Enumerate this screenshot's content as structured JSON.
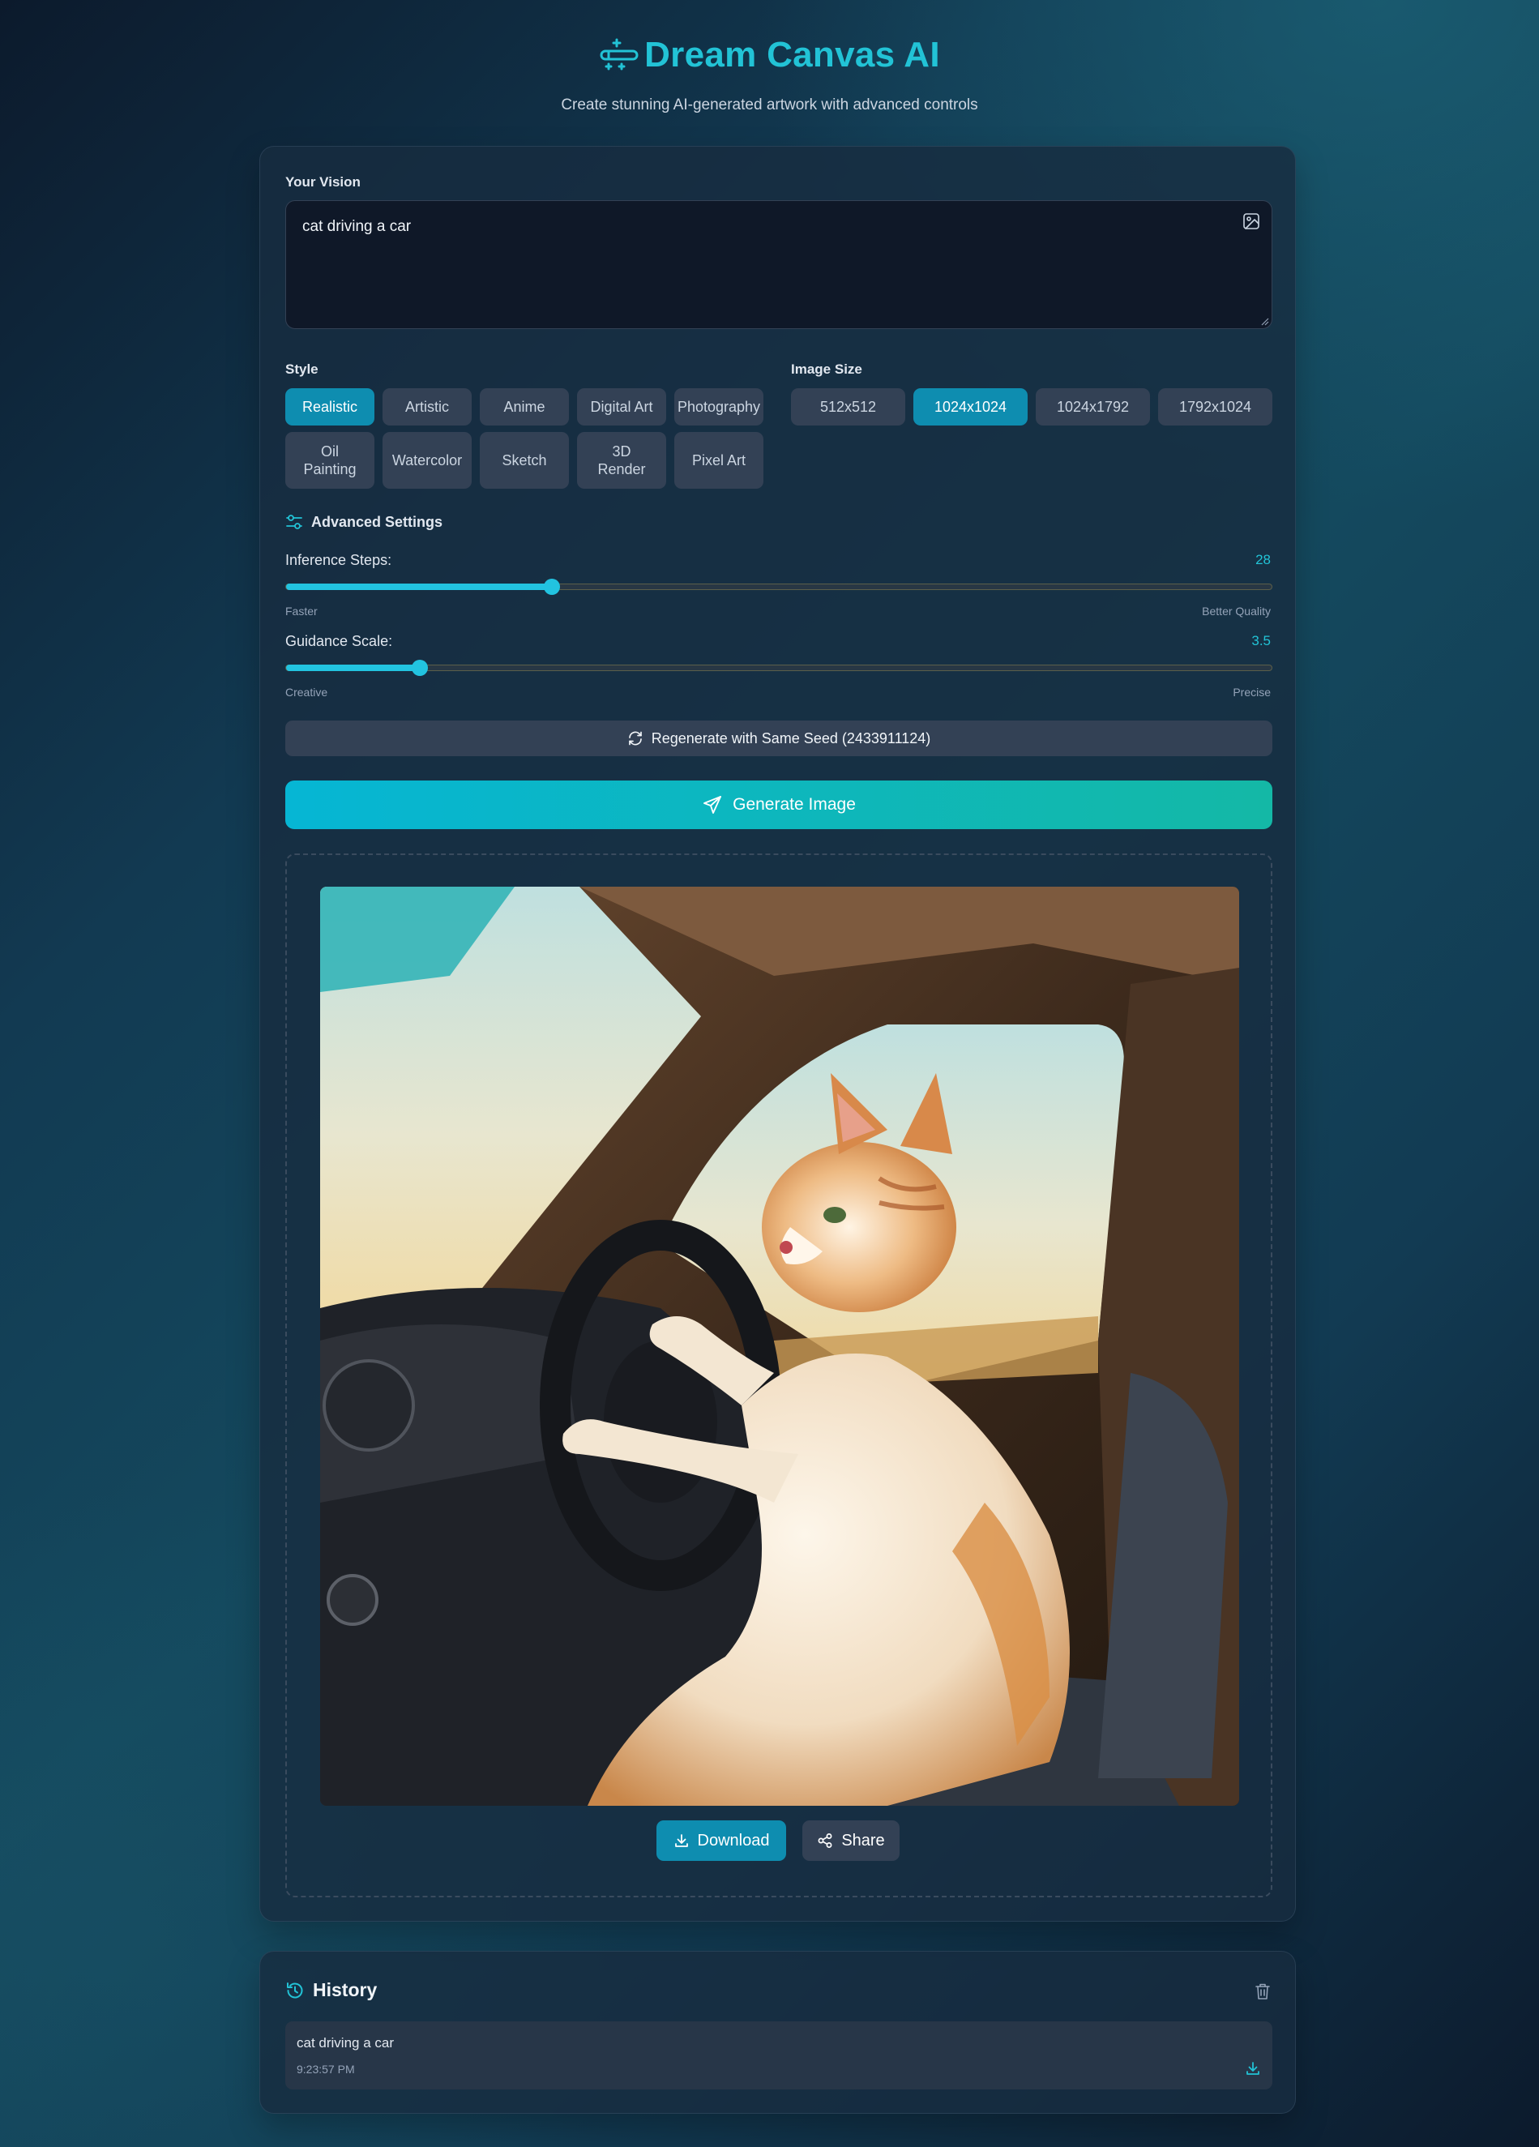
{
  "header": {
    "title": "Dream Canvas AI",
    "subtitle": "Create stunning AI-generated artwork with advanced controls"
  },
  "prompt": {
    "label": "Your Vision",
    "value": "cat driving a car"
  },
  "style": {
    "label": "Style",
    "options": [
      "Realistic",
      "Artistic",
      "Anime",
      "Digital Art",
      "Photography",
      "Oil Painting",
      "Watercolor",
      "Sketch",
      "3D Render",
      "Pixel Art"
    ],
    "selected": "Realistic"
  },
  "image_size": {
    "label": "Image Size",
    "options": [
      "512x512",
      "1024x1024",
      "1024x1792",
      "1792x1024"
    ],
    "selected": "1024x1024"
  },
  "advanced": {
    "label": "Advanced Settings",
    "inference_steps": {
      "label": "Inference Steps:",
      "value": "28",
      "fraction": 0.27,
      "min_hint": "Faster",
      "max_hint": "Better Quality"
    },
    "guidance_scale": {
      "label": "Guidance Scale:",
      "value": "3.5",
      "fraction": 0.136,
      "min_hint": "Creative",
      "max_hint": "Precise"
    }
  },
  "buttons": {
    "regenerate": "Regenerate with Same Seed (2433911124)",
    "generate": "Generate Image",
    "download": "Download",
    "share": "Share"
  },
  "history": {
    "title": "History",
    "items": [
      {
        "prompt": "cat driving a car",
        "time": "9:23:57 PM"
      }
    ]
  },
  "colors": {
    "accent": "#22c3d6",
    "active_chip": "#0e8db0",
    "chip": "#334155",
    "generate_gradient_start": "#06b6d4",
    "generate_gradient_end": "#14b8a6"
  }
}
